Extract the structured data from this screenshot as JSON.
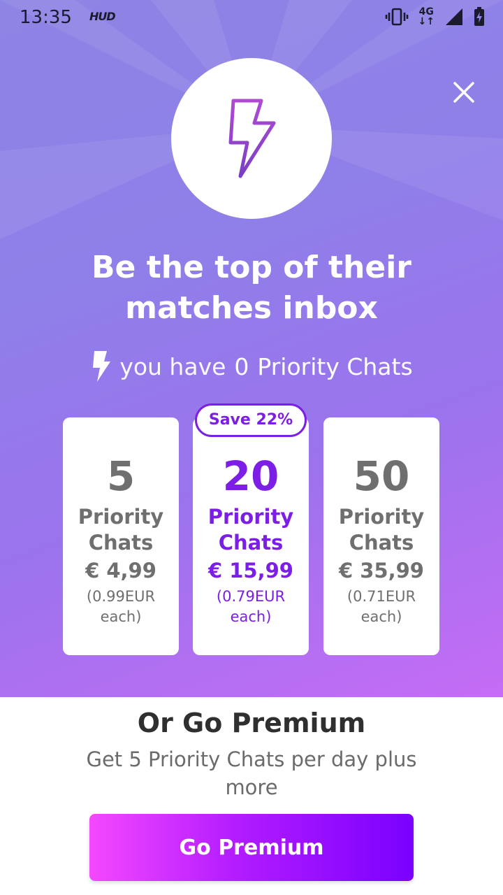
{
  "status_bar": {
    "time": "13:35",
    "app_badge": "HUD",
    "network": "4G",
    "icons": [
      "vibrate-icon",
      "network-4g-icon",
      "signal-icon",
      "battery-icon"
    ]
  },
  "header": {
    "close_icon": "close-icon",
    "hero_icon": "lightning-bolt-icon"
  },
  "headline": {
    "line1": "Be the top of their",
    "line2": "matches inbox"
  },
  "credits": {
    "lead": "you have",
    "count": "0",
    "label": "Priority Chats"
  },
  "plans": [
    {
      "qty": "5",
      "unit1": "Priority",
      "unit2": "Chats",
      "price": "€ 4,99",
      "each1": "(0.99EUR",
      "each2": "each)"
    },
    {
      "qty": "20",
      "unit1": "Priority",
      "unit2": "Chats",
      "price": "€ 15,99",
      "each1": "(0.79EUR",
      "each2": "each)",
      "badge": "Save 22%"
    },
    {
      "qty": "50",
      "unit1": "Priority",
      "unit2": "Chats",
      "price": "€ 35,99",
      "each1": "(0.71EUR",
      "each2": "each)"
    }
  ],
  "premium": {
    "title": "Or Go Premium",
    "subtitle": "Get 5 Priority Chats per day plus more",
    "button": "Go Premium"
  },
  "colors": {
    "accent": "#7c1ee6",
    "text_gray": "#6f6f6f",
    "gradient_start": "#f448ff",
    "gradient_end": "#7a00ff"
  }
}
